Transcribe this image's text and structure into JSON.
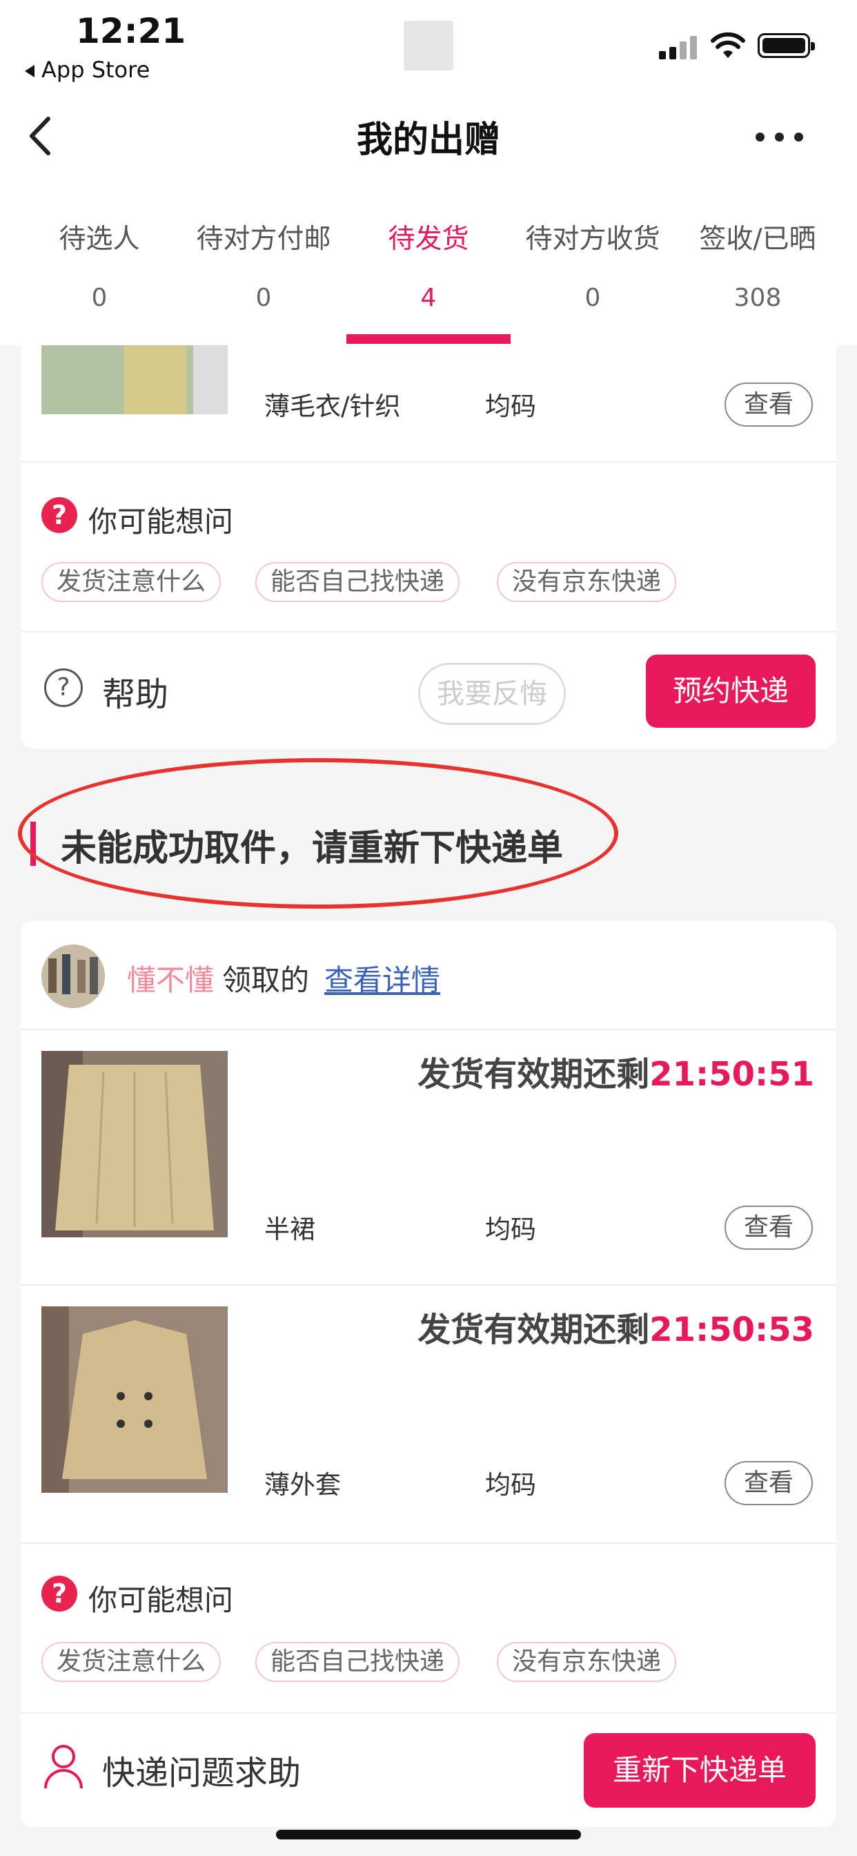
{
  "status_bar": {
    "time": "12:21",
    "back_app": "App Store"
  },
  "nav": {
    "title": "我的出赠"
  },
  "tabs": [
    {
      "label": "待选人",
      "count": "0",
      "active": false
    },
    {
      "label": "待对方付邮",
      "count": "0",
      "active": false
    },
    {
      "label": "待发货",
      "count": "4",
      "active": true
    },
    {
      "label": "待对方收货",
      "count": "0",
      "active": false
    },
    {
      "label": "签收/已晒",
      "count": "308",
      "active": false
    }
  ],
  "card1": {
    "product": {
      "name": "薄毛衣/针织",
      "size": "均码",
      "view_label": "查看"
    },
    "faq": {
      "title": "你可能想问",
      "chips": [
        "发货注意什么",
        "能否自己找快递",
        "没有京东快递"
      ]
    },
    "help_label": "帮助",
    "regret_label": "我要反悔",
    "action_label": "预约快递"
  },
  "section": {
    "title": "未能成功取件，请重新下快递单"
  },
  "card2": {
    "receiver_name": "懂不懂",
    "receiver_text": "领取的",
    "detail_link": "查看详情",
    "products": [
      {
        "countdown_prefix": "发货有效期还剩",
        "countdown_time": "21:50:51",
        "name": "半裙",
        "size": "均码",
        "view_label": "查看"
      },
      {
        "countdown_prefix": "发货有效期还剩",
        "countdown_time": "21:50:53",
        "name": "薄外套",
        "size": "均码",
        "view_label": "查看"
      }
    ],
    "faq": {
      "title": "你可能想问",
      "chips": [
        "发货注意什么",
        "能否自己找快递",
        "没有京东快递"
      ]
    },
    "help_label": "快递问题求助",
    "action_label": "重新下快递单"
  }
}
